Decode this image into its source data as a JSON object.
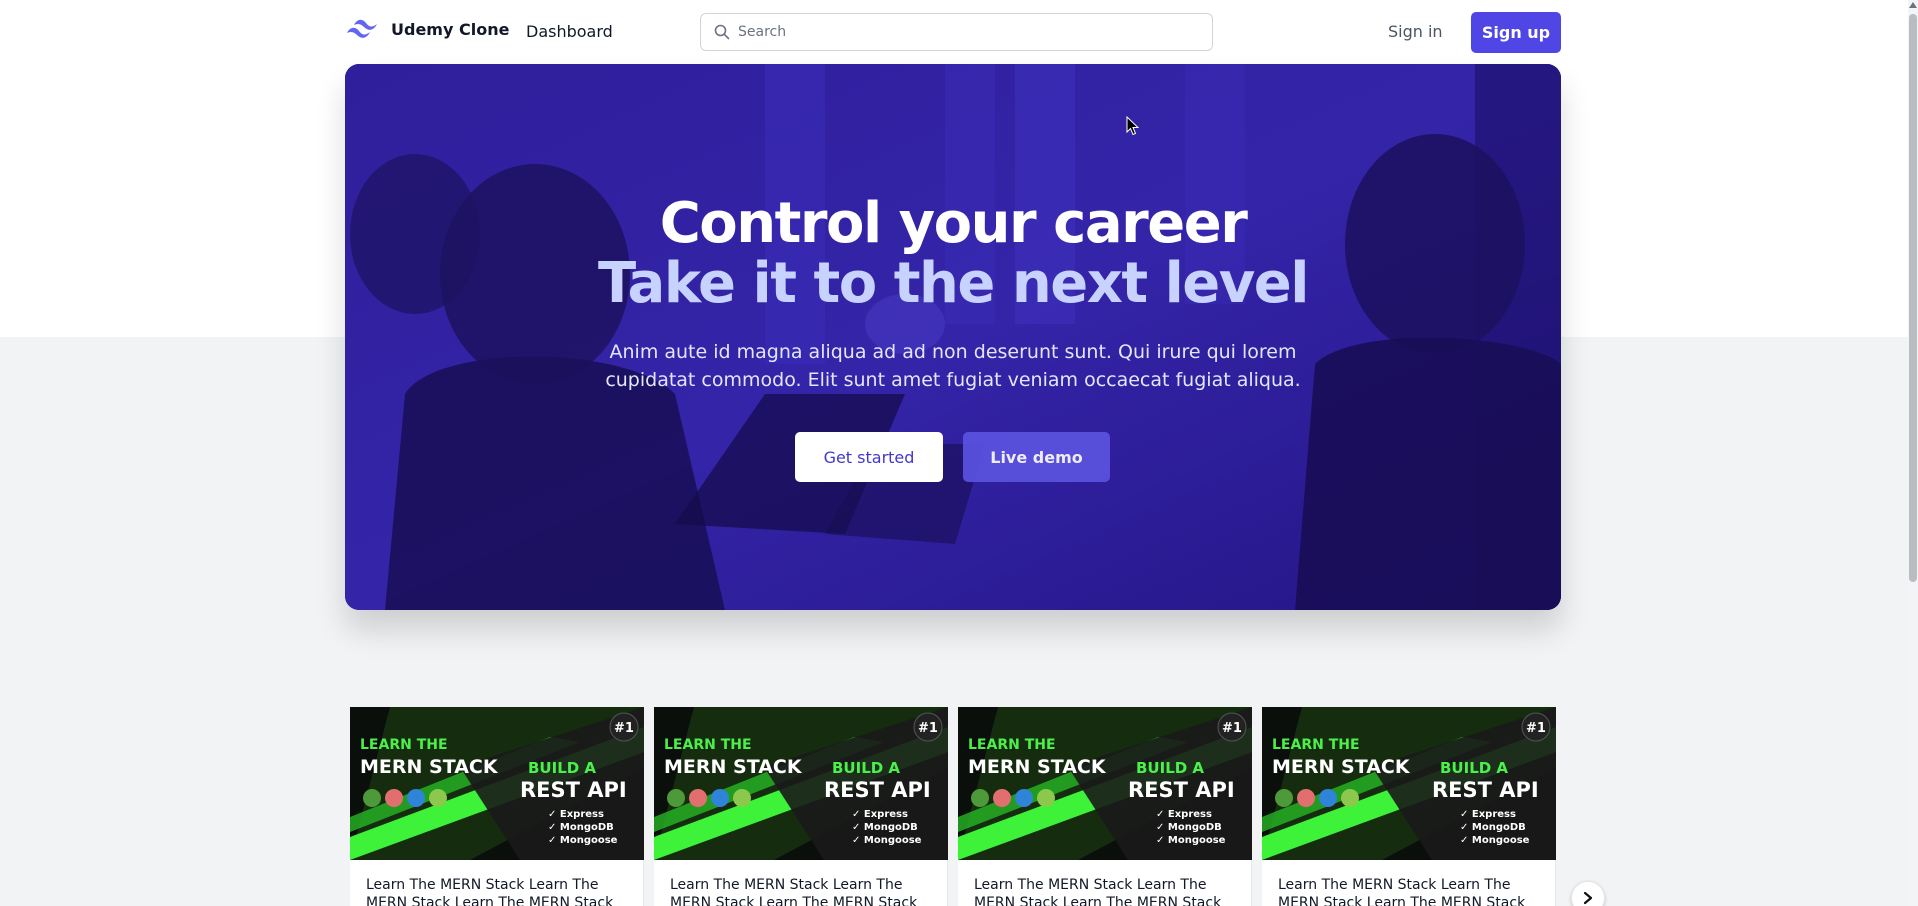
{
  "header": {
    "brand": "Udemy Clone",
    "nav_dashboard": "Dashboard",
    "search_placeholder": "Search",
    "signin": "Sign in",
    "signup": "Sign up"
  },
  "hero": {
    "title_line1": "Control your career",
    "title_line2": "Take it to the next level",
    "description": "Anim aute id magna aliqua ad ad non deserunt sunt. Qui irure qui lorem cupidatat commodo. Elit sunt amet fugiat veniam occaecat fugiat aliqua.",
    "cta_primary": "Get started",
    "cta_secondary": "Live demo"
  },
  "courses": [
    {
      "title": "Learn The MERN Stack Learn The MERN Stack Learn The MERN Stack",
      "badge": "#1",
      "thumb_line1": "LEARN THE",
      "thumb_line2": "MERN STACK",
      "thumb_line3": "BUILD A",
      "thumb_line4": "REST API",
      "thumb_items": [
        "Express",
        "MongoDB",
        "Mongoose"
      ]
    },
    {
      "title": "Learn The MERN Stack Learn The MERN Stack Learn The MERN Stack",
      "badge": "#1",
      "thumb_line1": "LEARN THE",
      "thumb_line2": "MERN STACK",
      "thumb_line3": "BUILD A",
      "thumb_line4": "REST API",
      "thumb_items": [
        "Express",
        "MongoDB",
        "Mongoose"
      ]
    },
    {
      "title": "Learn The MERN Stack Learn The MERN Stack Learn The MERN Stack",
      "badge": "#1",
      "thumb_line1": "LEARN THE",
      "thumb_line2": "MERN STACK",
      "thumb_line3": "BUILD A",
      "thumb_line4": "REST API",
      "thumb_items": [
        "Express",
        "MongoDB",
        "Mongoose"
      ]
    },
    {
      "title": "Learn The MERN Stack Learn The MERN Stack Learn The MERN Stack",
      "badge": "#1",
      "thumb_line1": "LEARN THE",
      "thumb_line2": "MERN STACK",
      "thumb_line3": "BUILD A",
      "thumb_line4": "REST API",
      "thumb_items": [
        "Express",
        "MongoDB",
        "Mongoose"
      ]
    }
  ],
  "colors": {
    "accent": "#4f46e5",
    "hero_overlay": "#2a1b8f",
    "hero_subtitle": "#c7d2fe"
  },
  "icons": {
    "logo": "tailwind-wave-icon",
    "search": "search-icon",
    "carousel_next": "chevron-right-icon"
  }
}
